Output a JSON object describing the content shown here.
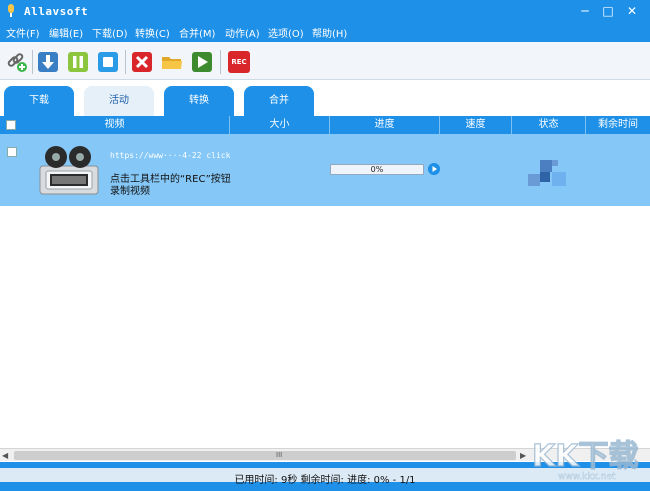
{
  "window": {
    "title": "Allavsoft",
    "minimize": "─",
    "maximize": "□",
    "close": "✕"
  },
  "menu": [
    "文件(F)",
    "编辑(E)",
    "下载(D)",
    "转换(C)",
    "合并(M)",
    "动作(A)",
    "选项(O)",
    "帮助(H)"
  ],
  "toolbar": {
    "icons": [
      "link-icon",
      "download-icon",
      "pause-icon",
      "stop-icon",
      "delete-icon",
      "folder-icon",
      "play-icon",
      "rec-icon"
    ],
    "rec_label": "REC"
  },
  "tabs": [
    {
      "label": "下载",
      "active": false
    },
    {
      "label": "活动",
      "active": true
    },
    {
      "label": "转换",
      "active": false
    },
    {
      "label": "合并",
      "active": false
    }
  ],
  "columns": [
    "视频",
    "大小",
    "进度",
    "速度",
    "状态",
    "剩余时间"
  ],
  "rows": [
    {
      "url": "https://www···-4-22 click",
      "hint_line1": "点击工具栏中的“REC”按钮",
      "hint_line2": "录制视频",
      "progress_text": "0%",
      "progress_fraction": 0
    }
  ],
  "scrollbar": {
    "grip": "III"
  },
  "status": {
    "text": "已用时间: 9秒  剩余时间:  进度: 0% - 1/1"
  },
  "watermark": {
    "text": "KK下载",
    "subtext": "www.kkx.net"
  },
  "colors": {
    "accent": "#1e90e8",
    "row_selected": "#85c7f6"
  }
}
